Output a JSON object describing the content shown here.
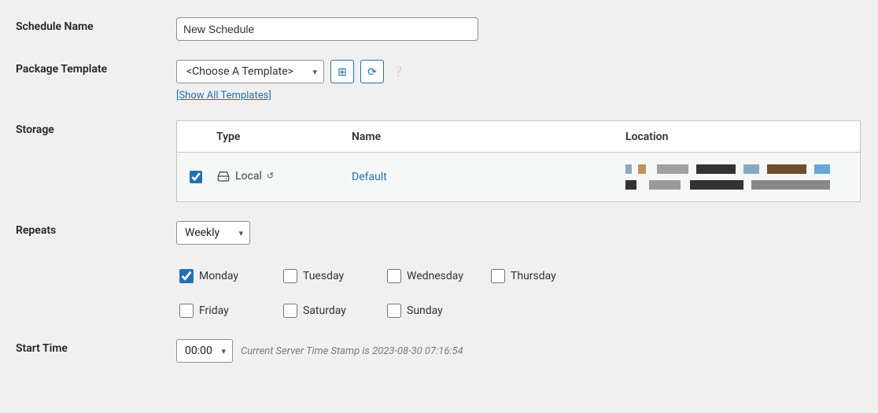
{
  "labels": {
    "schedule_name": "Schedule Name",
    "package_template": "Package Template",
    "storage": "Storage",
    "repeats": "Repeats",
    "start_time": "Start Time"
  },
  "schedule": {
    "name_value": "New Schedule"
  },
  "template": {
    "select_placeholder": "<Choose A Template>",
    "show_all_link": "[Show All Templates]"
  },
  "storage_table": {
    "headers": {
      "type": "Type",
      "name": "Name",
      "location": "Location"
    },
    "rows": [
      {
        "checked": true,
        "type_label": "Local",
        "name": "Default"
      }
    ]
  },
  "repeats": {
    "frequency": "Weekly",
    "days": [
      {
        "label": "Monday",
        "checked": true
      },
      {
        "label": "Tuesday",
        "checked": false
      },
      {
        "label": "Wednesday",
        "checked": false
      },
      {
        "label": "Thursday",
        "checked": false
      },
      {
        "label": "Friday",
        "checked": false
      },
      {
        "label": "Saturday",
        "checked": false
      },
      {
        "label": "Sunday",
        "checked": false
      }
    ]
  },
  "start_time": {
    "value": "00:00",
    "server_note": "Current Server Time Stamp is  2023-08-30 07:16:54"
  }
}
